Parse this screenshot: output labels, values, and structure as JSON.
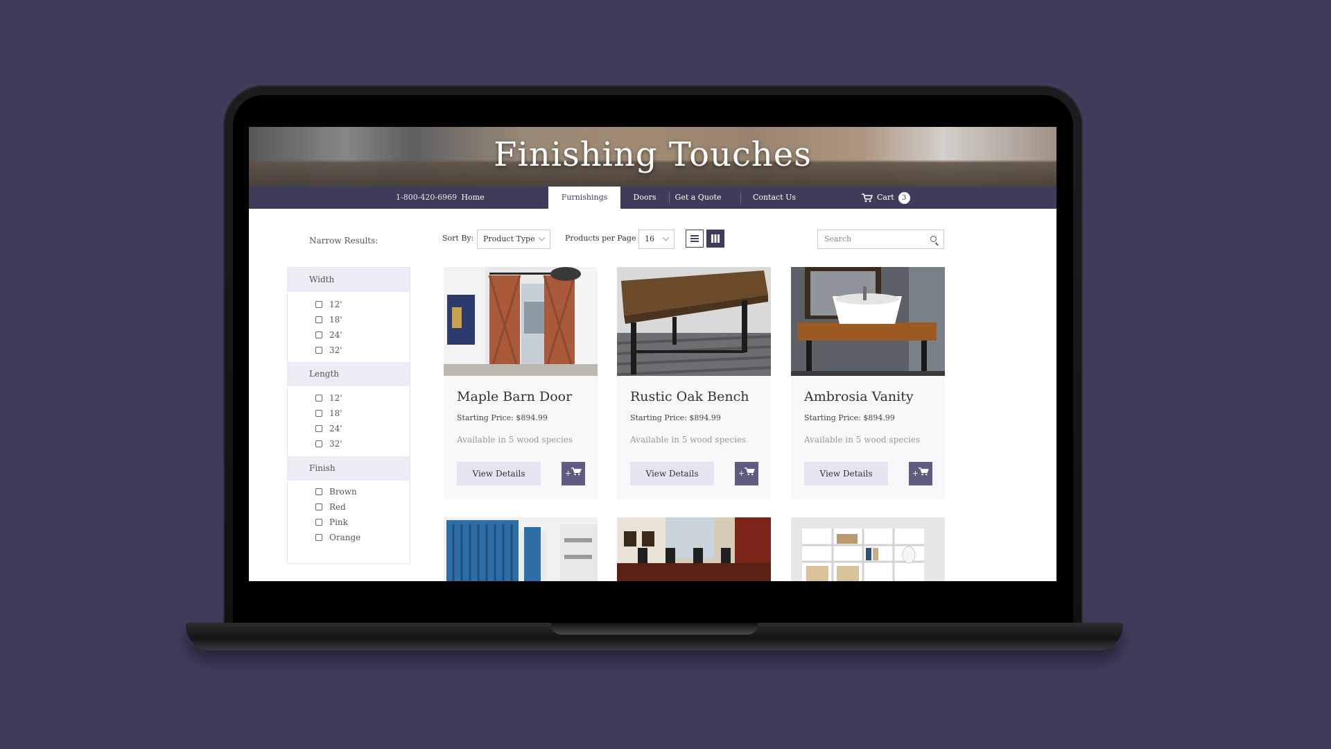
{
  "site": {
    "title": "Finishing Touches",
    "phone": "1-800-420-6969"
  },
  "nav": {
    "items": [
      {
        "label": "Home"
      },
      {
        "label": "Furnishings"
      },
      {
        "label": "Doors"
      },
      {
        "label": "Get a Quote"
      },
      {
        "label": "Contact Us"
      }
    ],
    "active": "Furnishings",
    "cart_label": "Cart",
    "cart_count": "3"
  },
  "sidebar": {
    "title": "Narrow Results:",
    "width": {
      "label": "Width",
      "options": [
        "12'",
        "18'",
        "24'",
        "32'"
      ]
    },
    "length": {
      "label": "Length",
      "options": [
        "12'",
        "18'",
        "24'",
        "32'"
      ]
    },
    "finish": {
      "label": "Finish",
      "options": [
        "Brown",
        "Red",
        "Pink",
        "Orange"
      ]
    }
  },
  "toolbar": {
    "sort_label": "Sort By:",
    "sort_value": "Product Type",
    "ppp_label": "Products per Page",
    "ppp_value": "16",
    "search_placeholder": "Search"
  },
  "products": [
    {
      "name": "Maple Barn Door",
      "price": "Starting Price: $894.99",
      "availability": "Available in 5 wood species",
      "button": "View Details",
      "cart_button": "+"
    },
    {
      "name": "Rustic Oak Bench",
      "price": "Starting Price: $894.99",
      "availability": "Available in 5 wood species",
      "button": "View Details",
      "cart_button": "+"
    },
    {
      "name": "Ambrosia Vanity",
      "price": "Starting Price: $894.99",
      "availability": "Available in 5 wood species",
      "button": "View Details",
      "cart_button": "+"
    }
  ],
  "colors": {
    "background": "#3f3d5b",
    "nav": "#3f3d5b",
    "filter_header": "#ececf4",
    "button": "#e5e5f1",
    "cart_button": "#5e5c7f"
  }
}
